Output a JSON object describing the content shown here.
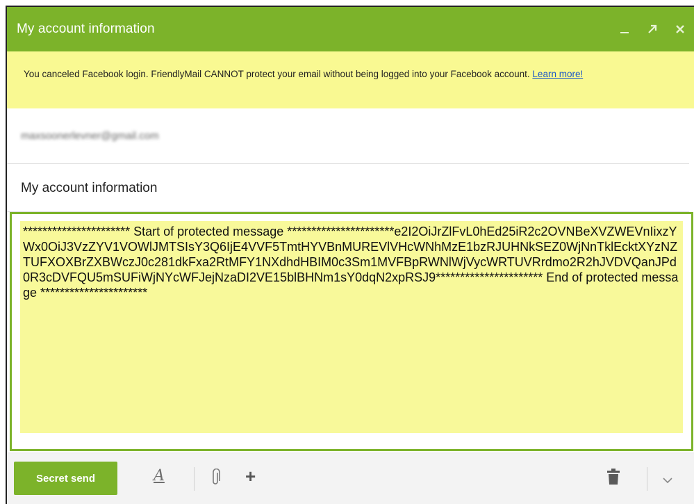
{
  "window": {
    "title": "My account information",
    "controls": {
      "minimize_icon": "minimize-icon",
      "popout_icon": "popout-icon",
      "close_icon": "close-icon"
    }
  },
  "warning": {
    "text": "You canceled Facebook login. FriendlyMail CANNOT protect your email without being logged into your Facebook account.",
    "link_text": "Learn more!"
  },
  "recipient": {
    "value": "maxsoonerlevner@gmail.com"
  },
  "subject": {
    "value": "My account information"
  },
  "body": {
    "text": "********************** Start of protected message **********************e2I2OiJrZlFvL0hEd25iR2c2OVNBeXVZWEVnIixzYWx0OiJ3VzZYV1VOWlJMTSIsY3Q6IjE4VVF5TmtHYVBnMUREVlVHcWNhMzE1bzRJUHNkSEZ0WjNnTklEcktXYzNZTUFXOXBrZXBWczJ0c281dkFxa2RtMFY1NXdhdHBIM0c3Sm1MVFBpRWNlWjVycWRTUVRrdmo2R2hJVDVQanJPd0R3cDVFQU5mSUFiWjNYcWFJejNzaDI2VE15blBHNm1sY0dqN2xpRSJ9********************** End of protected message **********************"
  },
  "footer": {
    "send_label": "Secret send",
    "font_icon_label": "A",
    "attach_icon": "paperclip-icon",
    "add_icon_label": "+",
    "trash_icon": "trash-icon",
    "more_icon": "chevron-down-icon"
  },
  "colors": {
    "accent": "#7cb32a",
    "warning_bg": "#f9f992",
    "protected_bg": "#f8f99a"
  }
}
